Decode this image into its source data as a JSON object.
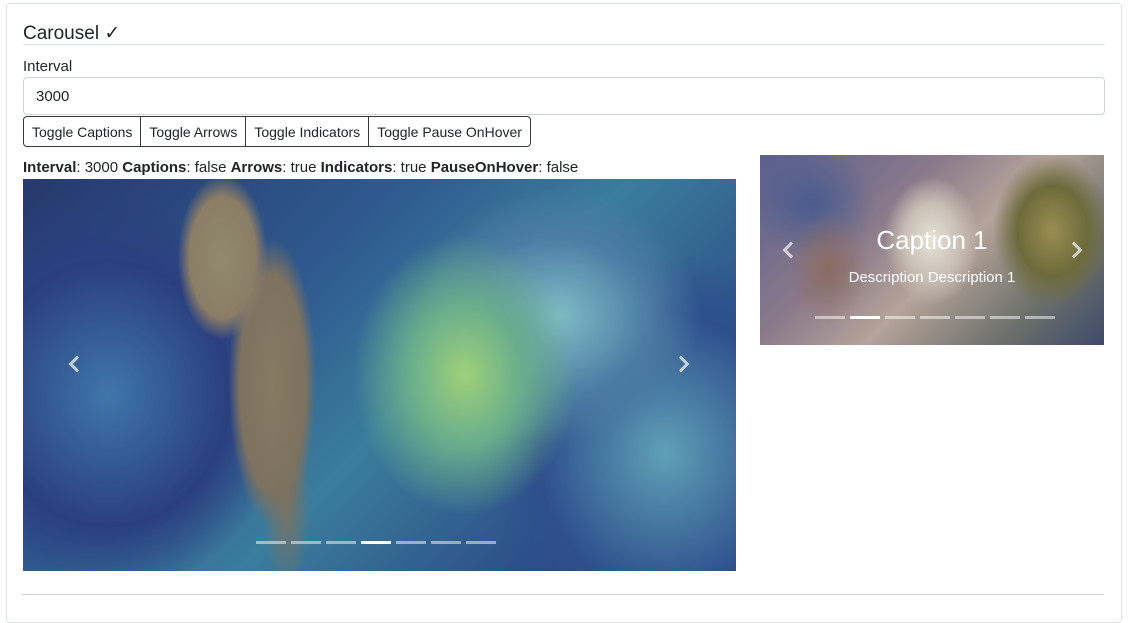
{
  "section": {
    "title": "Carousel ✓"
  },
  "interval": {
    "label": "Interval",
    "value": "3000"
  },
  "buttons": {
    "toggle_captions": "Toggle Captions",
    "toggle_arrows": "Toggle Arrows",
    "toggle_indicators": "Toggle Indicators",
    "toggle_pause": "Toggle Pause OnHover"
  },
  "status": {
    "interval_label": "Interval",
    "interval_value": ": 3000 ",
    "captions_label": "Captions",
    "captions_value": ": false ",
    "arrows_label": "Arrows",
    "arrows_value": ": true ",
    "indicators_label": "Indicators",
    "indicators_value": ": true ",
    "pause_label": "PauseOnHover",
    "pause_value": ": false"
  },
  "main_carousel": {
    "slide_count": 7,
    "active_index": 3
  },
  "side_carousel": {
    "slide_count": 7,
    "active_index": 1,
    "caption_title": "Caption 1",
    "caption_description": "Description Description 1"
  }
}
